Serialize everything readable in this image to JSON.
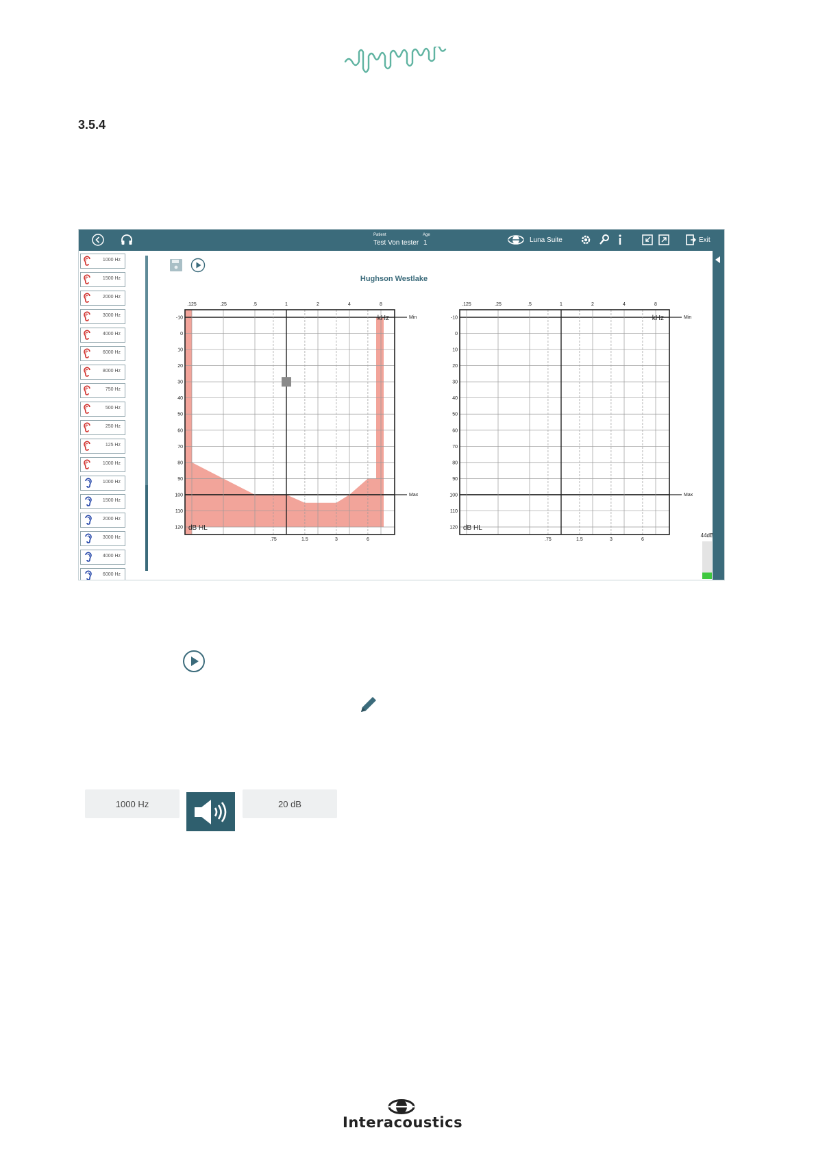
{
  "section": {
    "number": "3.5.4"
  },
  "topbar": {
    "patient_label": "Patient",
    "patient_name": "Test Von tester",
    "age_label": "Age",
    "age_value": "1",
    "suite_label": "Luna Suite",
    "exit_label": "Exit"
  },
  "sidebar": {
    "items": [
      {
        "ear": "right",
        "label": "1000 Hz"
      },
      {
        "ear": "right",
        "label": "1500 Hz"
      },
      {
        "ear": "right",
        "label": "2000 Hz"
      },
      {
        "ear": "right",
        "label": "3000 Hz"
      },
      {
        "ear": "right",
        "label": "4000 Hz"
      },
      {
        "ear": "right",
        "label": "6000 Hz"
      },
      {
        "ear": "right",
        "label": "8000 Hz"
      },
      {
        "ear": "right",
        "label": "750 Hz"
      },
      {
        "ear": "right",
        "label": "500 Hz"
      },
      {
        "ear": "right",
        "label": "250 Hz"
      },
      {
        "ear": "right",
        "label": "125 Hz"
      },
      {
        "ear": "right",
        "label": "1000 Hz"
      },
      {
        "ear": "left",
        "label": "1000 Hz"
      },
      {
        "ear": "left",
        "label": "1500 Hz"
      },
      {
        "ear": "left",
        "label": "2000 Hz"
      },
      {
        "ear": "left",
        "label": "3000 Hz"
      },
      {
        "ear": "left",
        "label": "4000 Hz"
      },
      {
        "ear": "left",
        "label": "6000 Hz"
      }
    ]
  },
  "chart": {
    "title": "Hughson Westlake",
    "top_ticks": [
      ".125",
      ".25",
      ".5",
      "1",
      "2",
      "4",
      "8"
    ],
    "bottom_ticks": [
      ".75",
      "1.5",
      "3",
      "6"
    ],
    "y_ticks": [
      "-10",
      "0",
      "10",
      "20",
      "30",
      "40",
      "50",
      "60",
      "70",
      "80",
      "90",
      "100",
      "110",
      "120"
    ],
    "unit_x": "kHz",
    "unit_y": "dB HL",
    "min_label": "Min",
    "max_label": "Max"
  },
  "level_meter": {
    "label": "44dB",
    "fraction": 0.35
  },
  "controls": {
    "frequency": "1000 Hz",
    "intensity": "20 dB"
  },
  "brand": {
    "name": "Interacoustics"
  },
  "colors": {
    "accent": "#3b6b7b",
    "masking": "#f2a49a",
    "marker": "#8a8a8a",
    "right_ear": "#d0312d",
    "left_ear": "#2446a8",
    "logo_wave": "#5fb3a1"
  },
  "chart_data": [
    {
      "type": "line",
      "name": "right",
      "x_ticks_top": [
        0.125,
        0.25,
        0.5,
        1,
        2,
        4,
        8
      ],
      "x_ticks_bottom": [
        0.75,
        1.5,
        3,
        6
      ],
      "ylim": [
        -10,
        120
      ],
      "ylabel": "dB HL",
      "xlabel": "kHz",
      "min_level": -10,
      "max_level": 100,
      "current_marker": {
        "x": 1,
        "y": 30
      },
      "masking_area": {
        "x": [
          0.125,
          0.125,
          0.25,
          0.5,
          1,
          1.5,
          2.2,
          3,
          4,
          6,
          7.2,
          7.2,
          8.5,
          8.5
        ],
        "y": [
          120,
          80,
          90,
          100,
          100,
          105,
          105,
          105,
          100,
          90,
          90,
          -10,
          -10,
          120
        ]
      }
    },
    {
      "type": "line",
      "name": "left",
      "x_ticks_top": [
        0.125,
        0.25,
        0.5,
        1,
        2,
        4,
        8
      ],
      "x_ticks_bottom": [
        0.75,
        1.5,
        3,
        6
      ],
      "ylim": [
        -10,
        120
      ],
      "ylabel": "dB HL",
      "xlabel": "kHz",
      "min_level": -10,
      "max_level": 100
    }
  ]
}
